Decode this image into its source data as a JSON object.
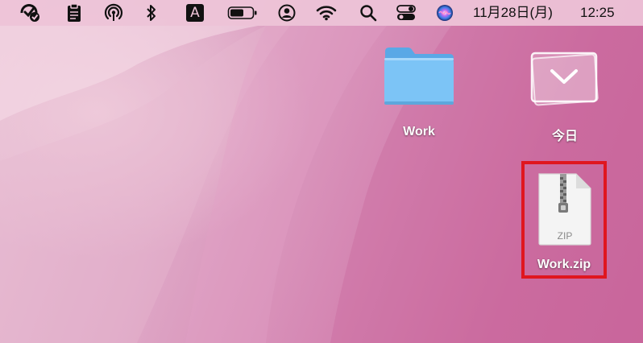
{
  "menubar": {
    "date_label": "11月28日(月)",
    "time_label": "12:25",
    "icons": [
      "checkmark-badge-icon",
      "clipboard-icon",
      "airdrop-icon",
      "bluetooth-icon",
      "input-source-icon",
      "battery-icon",
      "user-icon",
      "wifi-icon",
      "search-icon",
      "control-center-icon",
      "siri-icon"
    ],
    "input_source_letter": "A"
  },
  "desktop": {
    "items": [
      {
        "name": "Work",
        "kind": "folder",
        "folder_color": "#6fc0f2"
      },
      {
        "name": "今日",
        "kind": "stack"
      },
      {
        "name": "Work.zip",
        "kind": "zip",
        "type_label": "ZIP"
      }
    ],
    "highlight_color": "#e0161f"
  }
}
